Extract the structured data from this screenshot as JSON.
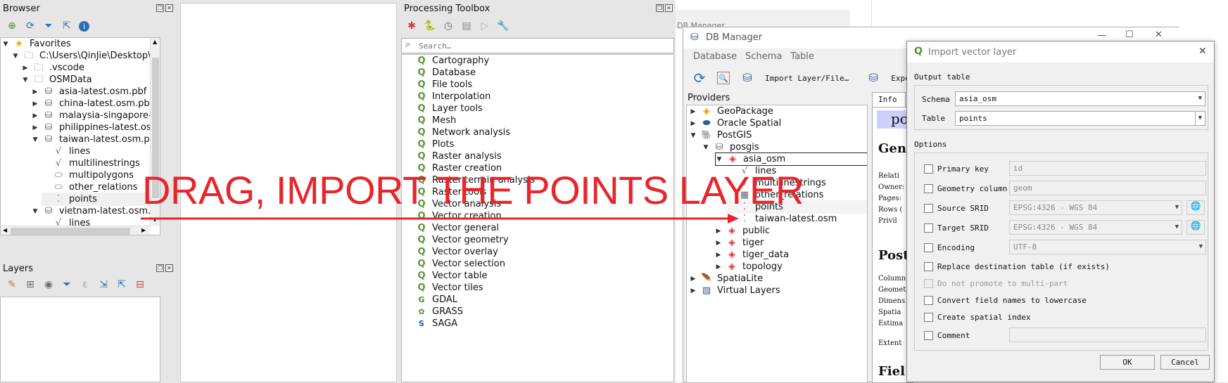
{
  "browser": {
    "title": "Browser",
    "toolbar_icons": [
      "add-layer-icon",
      "refresh-icon",
      "filter-icon",
      "collapse-icon",
      "info-icon"
    ],
    "items": [
      {
        "label": "Favorites",
        "icon": "★",
        "arrow": "▼",
        "indent": 0
      },
      {
        "label": "C:\\Users\\QinJie\\Desktop\\GeoA",
        "icon": "🗀",
        "arrow": "▼",
        "indent": 1
      },
      {
        "label": ".vscode",
        "icon": "🗀",
        "arrow": "▶",
        "indent": 2
      },
      {
        "label": "OSMData",
        "icon": "🗀",
        "arrow": "▼",
        "indent": 2
      },
      {
        "label": "asia-latest.osm.pbf",
        "icon": "⛁",
        "arrow": "▶",
        "indent": 3
      },
      {
        "label": "china-latest.osm.pbf",
        "icon": "⛁",
        "arrow": "▶",
        "indent": 3
      },
      {
        "label": "malaysia-singapore-brun",
        "icon": "⛁",
        "arrow": "▶",
        "indent": 3
      },
      {
        "label": "philippines-latest.osm.pb",
        "icon": "⛁",
        "arrow": "▶",
        "indent": 3
      },
      {
        "label": "taiwan-latest.osm.pbf",
        "icon": "⛁",
        "arrow": "▼",
        "indent": 3
      },
      {
        "label": "lines",
        "icon": "√",
        "arrow": "",
        "indent": 4
      },
      {
        "label": "multilinestrings",
        "icon": "√",
        "arrow": "",
        "indent": 4
      },
      {
        "label": "multipolygons",
        "icon": "⬭",
        "arrow": "",
        "indent": 4
      },
      {
        "label": "other_relations",
        "icon": "⬭",
        "arrow": "",
        "indent": 4
      },
      {
        "label": "points",
        "icon": "⁚",
        "arrow": "",
        "indent": 4
      },
      {
        "label": "vietnam-latest.osm.pbf",
        "icon": "⛁",
        "arrow": "▼",
        "indent": 3
      },
      {
        "label": "lines",
        "icon": "√",
        "arrow": "",
        "indent": 4
      }
    ]
  },
  "layers": {
    "title": "Layers"
  },
  "toolbox": {
    "title": "Processing Toolbox",
    "search_placeholder": "Search…",
    "items": [
      {
        "label": "Cartography",
        "icon": "Q"
      },
      {
        "label": "Database",
        "icon": "Q"
      },
      {
        "label": "File tools",
        "icon": "Q"
      },
      {
        "label": "Interpolation",
        "icon": "Q"
      },
      {
        "label": "Layer tools",
        "icon": "Q"
      },
      {
        "label": "Mesh",
        "icon": "Q"
      },
      {
        "label": "Network analysis",
        "icon": "Q"
      },
      {
        "label": "Plots",
        "icon": "Q"
      },
      {
        "label": "Raster analysis",
        "icon": "Q"
      },
      {
        "label": "Raster creation",
        "icon": "Q"
      },
      {
        "label": "Raster terrain analysis",
        "icon": "Q"
      },
      {
        "label": "Raster tools",
        "icon": "Q"
      },
      {
        "label": "Vector analysis",
        "icon": "Q"
      },
      {
        "label": "Vector creation",
        "icon": "Q"
      },
      {
        "label": "Vector general",
        "icon": "Q"
      },
      {
        "label": "Vector geometry",
        "icon": "Q"
      },
      {
        "label": "Vector overlay",
        "icon": "Q"
      },
      {
        "label": "Vector selection",
        "icon": "Q"
      },
      {
        "label": "Vector table",
        "icon": "Q"
      },
      {
        "label": "Vector tiles",
        "icon": "Q"
      },
      {
        "label": "GDAL",
        "icon": "G"
      },
      {
        "label": "GRASS",
        "icon": "✿"
      },
      {
        "label": "SAGA",
        "icon": "S"
      }
    ]
  },
  "bg_window_title": "DB Manager",
  "dbmanager": {
    "title": "DB Manager",
    "menu": [
      "Database",
      "Schema",
      "Table"
    ],
    "toolbar": {
      "import_label": "Import Layer/File…",
      "export_label": "Export"
    },
    "providers_label": "Providers",
    "tab_info": "Info",
    "providers": [
      {
        "label": "GeoPackage",
        "icon": "◈",
        "arrow": "▶",
        "indent": 0,
        "color": "#d4a017"
      },
      {
        "label": "Oracle Spatial",
        "icon": "⬬",
        "arrow": "▶",
        "indent": 0,
        "color": "#3a5a8c"
      },
      {
        "label": "PostGIS",
        "icon": "🐘",
        "arrow": "▼",
        "indent": 0,
        "color": "#336791"
      },
      {
        "label": "posgis",
        "icon": "⛁",
        "arrow": "▼",
        "indent": 1,
        "color": "#666"
      },
      {
        "label": "asia_osm",
        "icon": "◈",
        "arrow": "▼",
        "indent": 2,
        "color": "#d9363e"
      },
      {
        "label": "lines",
        "icon": "√",
        "arrow": "",
        "indent": 3,
        "color": "#666"
      },
      {
        "label": "multilinestrings",
        "icon": "√",
        "arrow": "",
        "indent": 3,
        "color": "#666"
      },
      {
        "label": "other_relations",
        "icon": "▦",
        "arrow": "",
        "indent": 3,
        "color": "#666"
      },
      {
        "label": "points",
        "icon": "⁚",
        "arrow": "",
        "indent": 3,
        "color": "#666"
      },
      {
        "label": "taiwan-latest.osm",
        "icon": "⁚",
        "arrow": "",
        "indent": 3,
        "color": "#666"
      },
      {
        "label": "public",
        "icon": "◈",
        "arrow": "▶",
        "indent": 2,
        "color": "#d9363e"
      },
      {
        "label": "tiger",
        "icon": "◈",
        "arrow": "▶",
        "indent": 2,
        "color": "#d9363e"
      },
      {
        "label": "tiger_data",
        "icon": "◈",
        "arrow": "▶",
        "indent": 2,
        "color": "#d9363e"
      },
      {
        "label": "topology",
        "icon": "◈",
        "arrow": "▶",
        "indent": 2,
        "color": "#d9363e"
      },
      {
        "label": "SpatiaLite",
        "icon": "🪶",
        "arrow": "▶",
        "indent": 0,
        "color": "#3a5a8c"
      },
      {
        "label": "Virtual Layers",
        "icon": "▧",
        "arrow": "▶",
        "indent": 0,
        "color": "#3a5a8c"
      }
    ],
    "info_heading": "po",
    "info_sections": [
      "Gene",
      "Post",
      "Fiel"
    ],
    "info_lines1": [
      "Relati",
      "Owner:",
      "Pages:",
      "Rows (",
      "Privil"
    ],
    "info_lines2": [
      "Column",
      "Geomet",
      "Dimens",
      "Spatia",
      "Estima"
    ],
    "info_extent": "Extent"
  },
  "import_dialog": {
    "title": "Import vector layer",
    "output_table_label": "Output table",
    "schema_label": "Schema",
    "schema_value": "asia_osm",
    "table_label": "Table",
    "table_value": "points",
    "options_label": "Options",
    "primary_key_label": "Primary key",
    "primary_key_value": "id",
    "geometry_column_label": "Geometry column",
    "geometry_column_value": "geom",
    "source_srid_label": "Source SRID",
    "source_srid_value": "EPSG:4326 - WGS 84",
    "target_srid_label": "Target SRID",
    "target_srid_value": "EPSG:4326 - WGS 84",
    "encoding_label": "Encoding",
    "encoding_value": "UTF-8",
    "replace_label": "Replace destination table (if exists)",
    "no_promote_label": "Do not promote to multi-part",
    "lowercase_label": "Convert field names to lowercase",
    "spatial_index_label": "Create spatial index",
    "comment_label": "Comment",
    "ok_label": "OK",
    "cancel_label": "Cancel"
  },
  "annotation": {
    "text": "DRAG, IMPORT THE POINTS LAYER",
    "color": "#e8252b"
  },
  "colors": {
    "qgis_green": "#589632",
    "annotation_red": "#e8252b"
  }
}
